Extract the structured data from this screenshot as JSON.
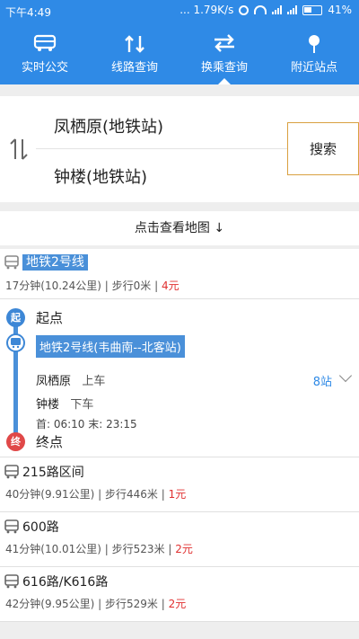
{
  "status_bar": {
    "time": "下午4:49",
    "network_speed": "... 1.79K/s",
    "battery": "41%"
  },
  "tabs": [
    {
      "label": "实时公交",
      "icon": "bus-icon"
    },
    {
      "label": "线路查询",
      "icon": "route-arrows-icon"
    },
    {
      "label": "换乘查询",
      "icon": "transfer-arrows-icon",
      "active": true
    },
    {
      "label": "附近站点",
      "icon": "pin-icon"
    }
  ],
  "route_input": {
    "from": "凤栖原(地铁站)",
    "to": "钟楼(地铁站)",
    "search_label": "搜索"
  },
  "map_link": "点击查看地图 ↓",
  "plans": [
    {
      "title": "地铁2号线",
      "meta": "17分钟(10.24公里) | 步行0米 | ",
      "price": "4元",
      "expanded": true,
      "detail": {
        "start_badge": "起",
        "start_label": "起点",
        "line_name": "地铁2号线(韦曲南--北客站)",
        "board_station": "凤栖原",
        "board_action": "上车",
        "alight_station": "钟楼",
        "alight_action": "下车",
        "hours": "首: 06:10 末: 23:15",
        "stops": "8站",
        "end_badge": "终",
        "end_label": "终点"
      }
    },
    {
      "title": "215路区间",
      "meta": "40分钟(9.91公里) | 步行446米 | ",
      "price": "1元"
    },
    {
      "title": "600路",
      "meta": "41分钟(10.01公里) | 步行523米 | ",
      "price": "2元"
    },
    {
      "title": "616路/K616路",
      "meta": "42分钟(9.95公里) | 步行529米 | ",
      "price": "2元"
    }
  ],
  "colors": {
    "primary": "#2f8ae6",
    "price": "#e03030",
    "end_node": "#e04848"
  }
}
